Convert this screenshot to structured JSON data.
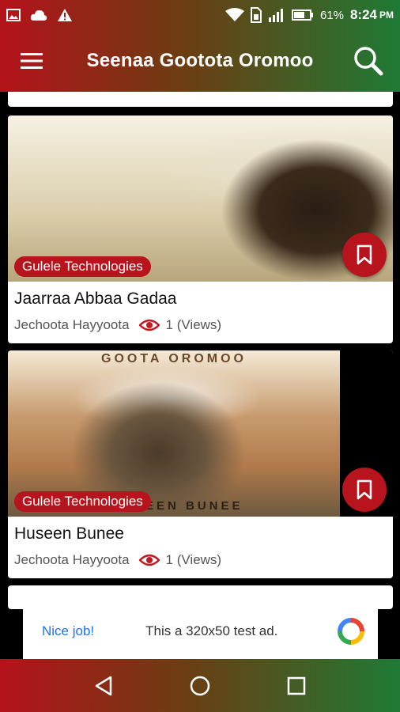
{
  "status_bar": {
    "battery": "61%",
    "time": "8:24",
    "ampm": "PM",
    "icons": [
      "image-icon",
      "cloud-icon",
      "warning-icon",
      "wifi-icon",
      "sim-icon",
      "signal-icon",
      "battery-icon"
    ]
  },
  "app_bar": {
    "title": "Seenaa Gootota Oromoo",
    "menu_icon": "hamburger-menu-icon",
    "search_icon": "search-icon"
  },
  "cards": [
    {
      "badge": "Gulele Technologies",
      "title": "Jaarraa Abbaa Gadaa",
      "category": "Jechoota Hayyoota",
      "views": "1 (Views)"
    },
    {
      "badge": "Gulele Technologies",
      "title": "Huseen Bunee",
      "category": "Jechoota Hayyoota",
      "views": "1 (Views)",
      "image_caption": "GOOTA OROMOO",
      "image_bottom_text": "SEEN BUNEE"
    }
  ],
  "ad": {
    "left": "Nice job!",
    "text": "This a 320x50 test ad."
  },
  "colors": {
    "accent": "#b7141d",
    "gradient_start": "#b5121b",
    "gradient_end": "#1f7a35"
  }
}
